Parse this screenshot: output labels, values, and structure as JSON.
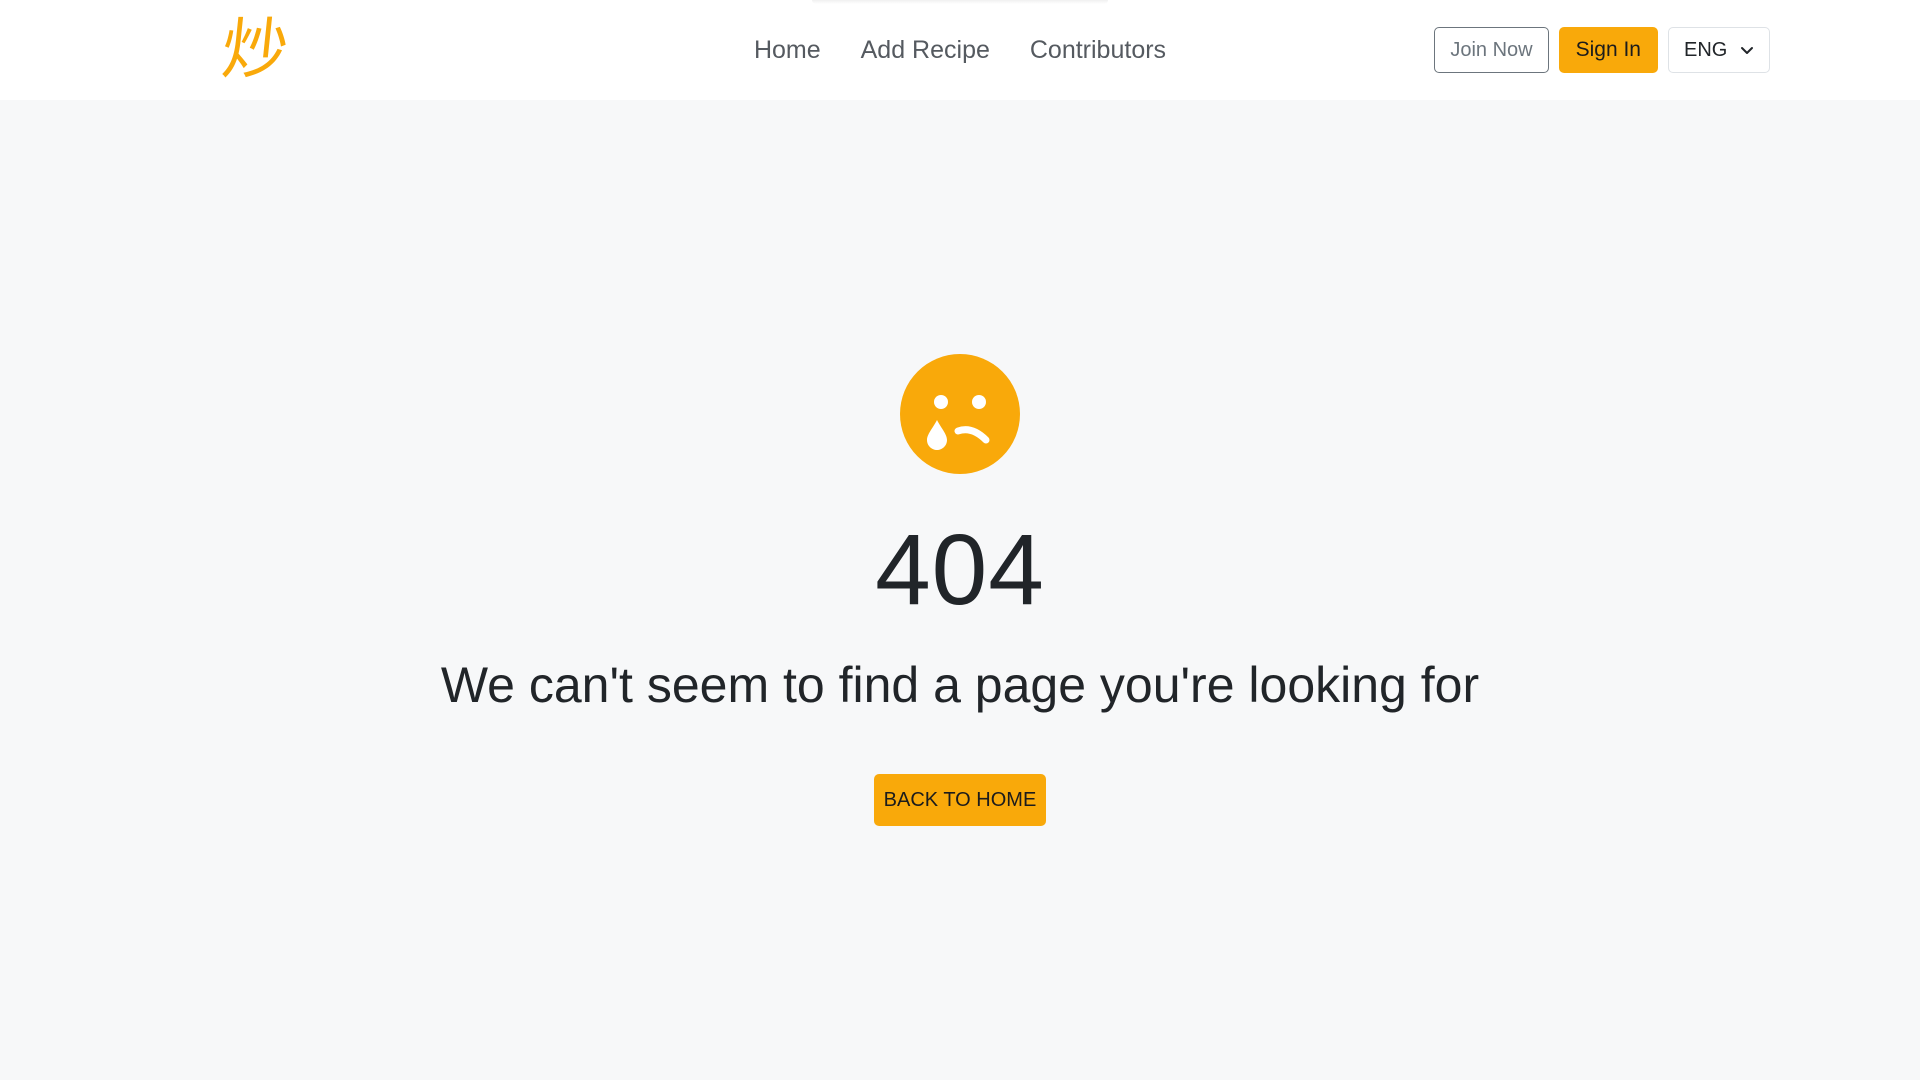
{
  "colors": {
    "accent": "#f9a90a",
    "page_background": "#f7f8f9",
    "navbar_background": "#ffffff",
    "text_dark": "#212529",
    "nav_link": "#555a60"
  },
  "header": {
    "logo_text": "炒",
    "nav": [
      {
        "label": "Home"
      },
      {
        "label": "Add Recipe"
      },
      {
        "label": "Contributors"
      }
    ],
    "join_label": "Join Now",
    "signin_label": "Sign In",
    "language": {
      "selected": "ENG",
      "icon": "chevron-down-icon"
    }
  },
  "error": {
    "icon": "sad-face-icon",
    "code": "404",
    "message": "We can't seem to find a page you're looking for",
    "button_label": "BACK TO HOME"
  }
}
